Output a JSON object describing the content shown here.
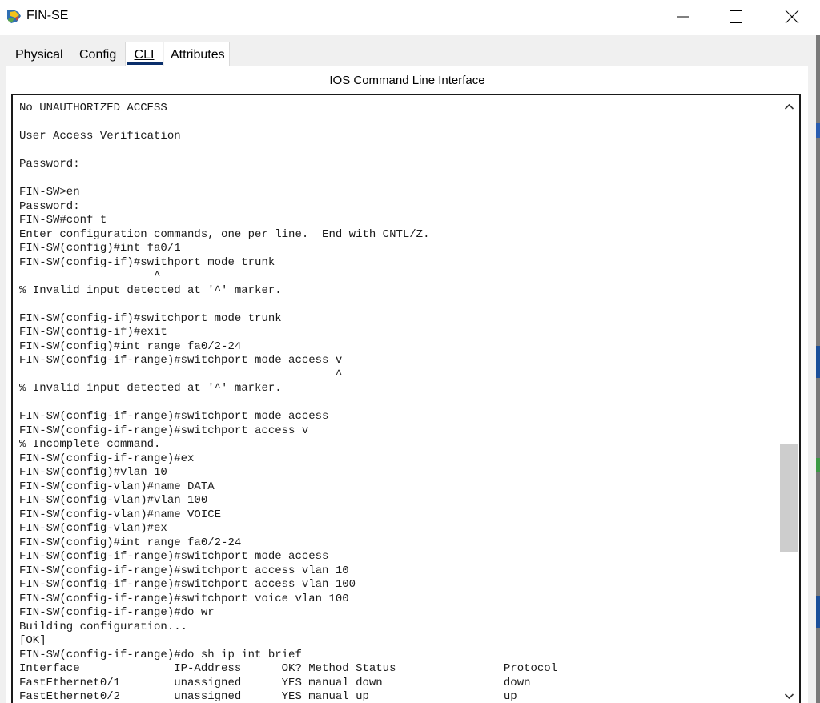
{
  "window": {
    "title": "FIN-SE",
    "icon": "packet-tracer-switch-icon"
  },
  "tabs": [
    {
      "label": "Physical"
    },
    {
      "label": "Config"
    },
    {
      "label": "CLI",
      "active": true
    },
    {
      "label": "Attributes"
    }
  ],
  "cli": {
    "header": "IOS Command Line Interface",
    "output": "No UNAUTHORIZED ACCESS\n\nUser Access Verification\n\nPassword:\n\nFIN-SW>en\nPassword:\nFIN-SW#conf t\nEnter configuration commands, one per line.  End with CNTL/Z.\nFIN-SW(config)#int fa0/1\nFIN-SW(config-if)#swithport mode trunk\n                    ^\n% Invalid input detected at '^' marker.\n\nFIN-SW(config-if)#switchport mode trunk\nFIN-SW(config-if)#exit\nFIN-SW(config)#int range fa0/2-24\nFIN-SW(config-if-range)#switchport mode access v\n                                               ^\n% Invalid input detected at '^' marker.\n\nFIN-SW(config-if-range)#switchport mode access\nFIN-SW(config-if-range)#switchport access v\n% Incomplete command.\nFIN-SW(config-if-range)#ex\nFIN-SW(config)#vlan 10\nFIN-SW(config-vlan)#name DATA\nFIN-SW(config-vlan)#vlan 100\nFIN-SW(config-vlan)#name VOICE\nFIN-SW(config-vlan)#ex\nFIN-SW(config)#int range fa0/2-24\nFIN-SW(config-if-range)#switchport mode access\nFIN-SW(config-if-range)#switchport access vlan 10\nFIN-SW(config-if-range)#switchport access vlan 100\nFIN-SW(config-if-range)#switchport voice vlan 100\nFIN-SW(config-if-range)#do wr\nBuilding configuration...\n[OK]\nFIN-SW(config-if-range)#do sh ip int brief\nInterface              IP-Address      OK? Method Status                Protocol\nFastEthernet0/1        unassigned      YES manual down                  down\nFastEthernet0/2        unassigned      YES manual up                    up"
  },
  "colors": {
    "tab_underline": "#0a2f6b",
    "terminal_text": "#1a1a1a",
    "window_bg": "#f0f0f0"
  }
}
